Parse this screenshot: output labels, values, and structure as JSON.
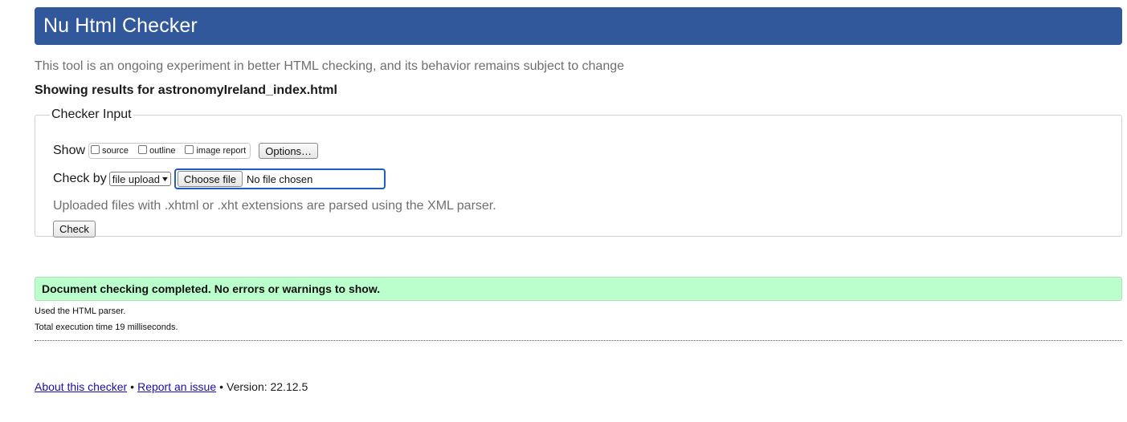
{
  "header": {
    "title": "Nu Html Checker",
    "background_color": "#30589b"
  },
  "intro": "This tool is an ongoing experiment in better HTML checking, and its behavior remains subject to change",
  "results_for": "Showing results for astronomyIreland_index.html",
  "checker_input": {
    "legend": "Checker Input",
    "show_label": "Show",
    "show_options": [
      {
        "label": "source",
        "checked": false
      },
      {
        "label": "outline",
        "checked": false
      },
      {
        "label": "image report",
        "checked": false
      }
    ],
    "options_button": "Options…",
    "check_by_label": "Check by",
    "check_by_selected": "file upload",
    "choose_file_button": "Choose file",
    "file_status": "No file chosen",
    "upload_note": "Uploaded files with .xhtml or .xht extensions are parsed using the XML parser.",
    "check_button": "Check"
  },
  "result": {
    "message": "Document checking completed. No errors or warnings to show.",
    "background_color": "#bbffcc",
    "parser_note": "Used the HTML parser.",
    "execution_time": "Total execution time 19 milliseconds."
  },
  "footer": {
    "about_link": "About this checker",
    "separator": "•",
    "report_link": "Report an issue",
    "version": "Version: 22.12.5"
  }
}
